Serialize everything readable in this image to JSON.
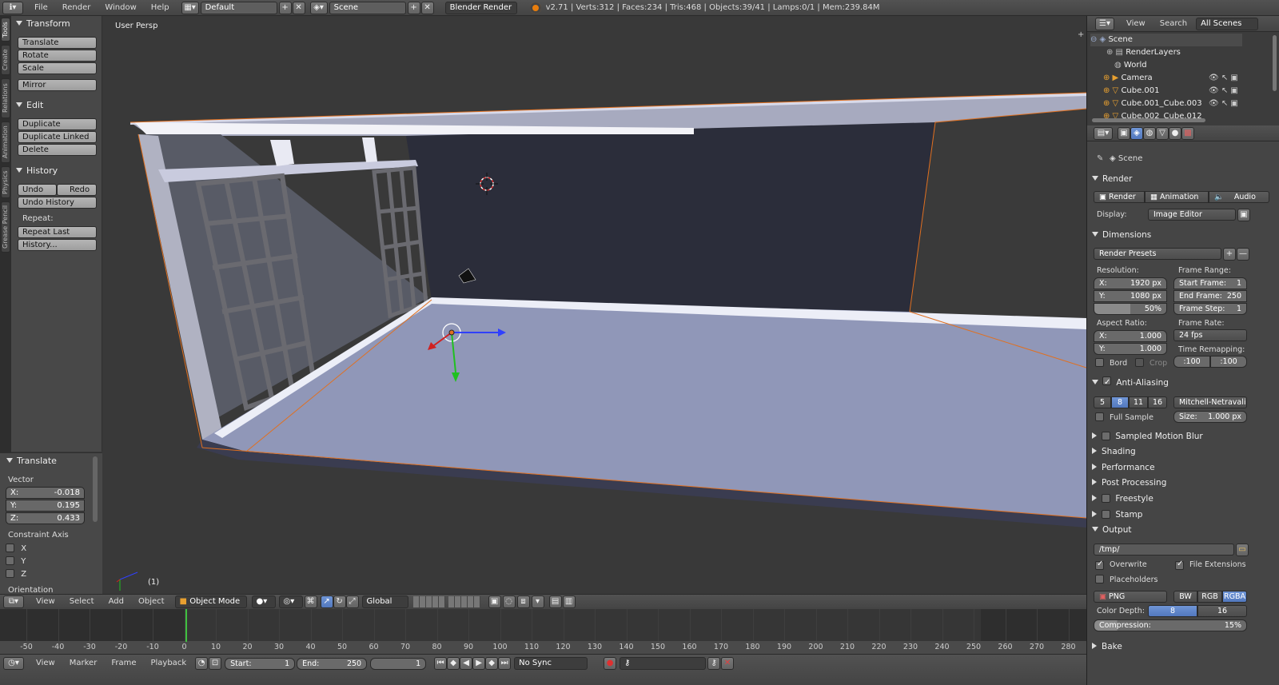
{
  "app": {
    "menus": [
      "File",
      "Render",
      "Window",
      "Help"
    ],
    "screen_layout": "Default",
    "scene": "Scene",
    "engine": "Blender Render",
    "stats": "v2.71 | Verts:312 | Faces:234 | Tris:468 | Objects:39/41 | Lamps:0/1 | Mem:239.84M"
  },
  "left_tabs": [
    "Tools",
    "Create",
    "Relations",
    "Animation",
    "Physics",
    "Grease Pencil"
  ],
  "tools": {
    "transform": {
      "title": "Transform",
      "buttons": [
        "Translate",
        "Rotate",
        "Scale",
        "Mirror"
      ]
    },
    "edit": {
      "title": "Edit",
      "buttons": [
        "Duplicate",
        "Duplicate Linked",
        "Delete"
      ]
    },
    "history": {
      "title": "History",
      "undo": "Undo",
      "redo": "Redo",
      "undo_history": "Undo History",
      "repeat_label": "Repeat:",
      "repeat_last": "Repeat Last",
      "history_more": "History..."
    }
  },
  "operator": {
    "title": "Translate",
    "vector_label": "Vector",
    "x": "X:",
    "xv": "-0.018",
    "y": "Y:",
    "yv": "0.195",
    "z": "Z:",
    "zv": "0.433",
    "constraint_label": "Constraint Axis",
    "cx": "X",
    "cy": "Y",
    "cz": "Z",
    "orientation": "Orientation"
  },
  "viewport": {
    "view_name": "User Persp",
    "frame_indicator": "(1)"
  },
  "v3d_header": {
    "menus": [
      "View",
      "Select",
      "Add",
      "Object"
    ],
    "mode": "Object Mode",
    "orientation": "Global"
  },
  "timeline": {
    "ticks": [
      "-50",
      "-40",
      "-30",
      "-20",
      "-10",
      "0",
      "10",
      "20",
      "30",
      "40",
      "50",
      "60",
      "70",
      "80",
      "90",
      "100",
      "110",
      "120",
      "130",
      "140",
      "150",
      "160",
      "170",
      "180",
      "190",
      "200",
      "210",
      "220",
      "230",
      "240",
      "250",
      "260",
      "270",
      "280"
    ],
    "current_frame": 0,
    "menus": [
      "View",
      "Marker",
      "Frame",
      "Playback"
    ],
    "start_label": "Start:",
    "start": "1",
    "end_label": "End:",
    "end": "250",
    "frame": "1",
    "sync": "No Sync"
  },
  "outliner": {
    "menus": [
      "View",
      "Search"
    ],
    "filter": "All Scenes",
    "items": [
      "Scene",
      "RenderLayers",
      "World",
      "Camera",
      "Cube.001",
      "Cube.001_Cube.003",
      "Cube.002_Cube.012"
    ]
  },
  "properties": {
    "context": "Scene",
    "render": {
      "title": "Render",
      "render_btn": "Render",
      "animation_btn": "Animation",
      "audio_btn": "Audio",
      "display_label": "Display:",
      "display": "Image Editor"
    },
    "dimensions": {
      "title": "Dimensions",
      "presets": "Render Presets",
      "resolution_label": "Resolution:",
      "res_x_label": "X:",
      "res_x": "1920 px",
      "res_y_label": "Y:",
      "res_y": "1080 px",
      "res_pct": "50%",
      "frame_range_label": "Frame Range:",
      "start_frame_label": "Start Frame:",
      "start_frame": "1",
      "end_frame_label": "End Frame:",
      "end_frame": "250",
      "frame_step_label": "Frame Step:",
      "frame_step": "1",
      "aspect_label": "Aspect Ratio:",
      "asp_x_label": "X:",
      "asp_x": "1.000",
      "asp_y_label": "Y:",
      "asp_y": "1.000",
      "frame_rate_label": "Frame Rate:",
      "frame_rate": "24 fps",
      "time_remap_label": "Time Remapping:",
      "remap_old": ":100",
      "remap_new": ":100",
      "bord": "Bord",
      "crop": "Crop"
    },
    "aa": {
      "title": "Anti-Aliasing",
      "samples": [
        "5",
        "8",
        "11",
        "16"
      ],
      "selected": "8",
      "filter": "Mitchell-Netravali",
      "full_sample": "Full Sample",
      "size_label": "Size:",
      "size": "1.000 px"
    },
    "collapsed": [
      "Sampled Motion Blur",
      "Shading",
      "Performance",
      "Post Processing",
      "Freestyle",
      "Stamp"
    ],
    "output": {
      "title": "Output",
      "path": "/tmp/",
      "overwrite": "Overwrite",
      "file_ext": "File Extensions",
      "placeholders": "Placeholders",
      "format": "PNG",
      "bw": "BW",
      "rgb": "RGB",
      "rgba": "RGBA",
      "color_depth_label": "Color Depth:",
      "depth8": "8",
      "depth16": "16",
      "compression_label": "Compression:",
      "compression": "15%"
    },
    "bake": {
      "title": "Bake"
    }
  },
  "colors": {
    "accent": "#5680c2",
    "selection_outline": "#e07020",
    "floor": "#9097b8"
  }
}
